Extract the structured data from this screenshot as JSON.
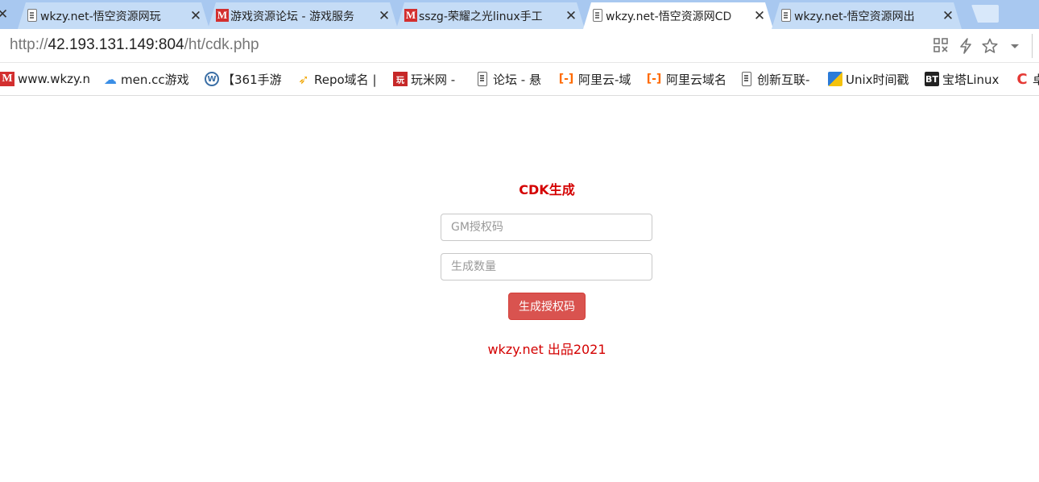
{
  "browser": {
    "tabs": [
      {
        "title": "wkzy.net-悟空资源网玩",
        "icon": "document-icon",
        "active": false
      },
      {
        "title": "游戏资源论坛 - 游戏服务",
        "icon": "m-logo-icon",
        "active": false
      },
      {
        "title": "sszg-荣耀之光linux手工",
        "icon": "m-logo-icon",
        "active": false
      },
      {
        "title": "wkzy.net-悟空资源网CD",
        "icon": "document-icon",
        "active": true
      },
      {
        "title": "wkzy.net-悟空资源网出",
        "icon": "document-icon",
        "active": false
      }
    ],
    "close_glyph": "✕",
    "url_scheme": "http://",
    "url_host": "42.193.131.149:804",
    "url_path": "/ht/cdk.php",
    "toolbar_icons": [
      "qr-code-icon",
      "lightning-icon",
      "star-icon",
      "dropdown-icon"
    ]
  },
  "bookmarks": [
    {
      "label": "www.wkzy.n",
      "icon": "m-logo-icon",
      "glyph": "M"
    },
    {
      "label": "men.cc游戏",
      "icon": "cloud-icon",
      "glyph": "☁"
    },
    {
      "label": "【361手游",
      "icon": "wordpress-icon",
      "glyph": "W"
    },
    {
      "label": "Repo域名 |",
      "icon": "repo-icon",
      "glyph": "➶"
    },
    {
      "label": "玩米网 -",
      "icon": "wanmi-icon",
      "glyph": "玩"
    },
    {
      "label": "论坛 - 悬",
      "icon": "document-icon",
      "glyph": ""
    },
    {
      "label": "阿里云-域",
      "icon": "aliyun-icon",
      "glyph": "[-]"
    },
    {
      "label": "阿里云域名",
      "icon": "aliyun-icon",
      "glyph": "[-]"
    },
    {
      "label": "创新互联-",
      "icon": "document-icon",
      "glyph": ""
    },
    {
      "label": "Unix时间戳",
      "icon": "unix-icon",
      "glyph": ""
    },
    {
      "label": "宝塔Linux",
      "icon": "bt-icon",
      "glyph": "BT"
    },
    {
      "label": "卓",
      "icon": "c-logo-icon",
      "glyph": "C"
    }
  ],
  "page": {
    "title": "CDK生成",
    "gm_placeholder": "GM授权码",
    "gm_value": "",
    "count_placeholder": "生成数量",
    "count_value": "",
    "button_label": "生成授权码",
    "footer": "wkzy.net 出品2021"
  },
  "colors": {
    "accent_red": "#d40000",
    "button_red": "#d9534f",
    "tabstrip": "#a8c8f0"
  }
}
